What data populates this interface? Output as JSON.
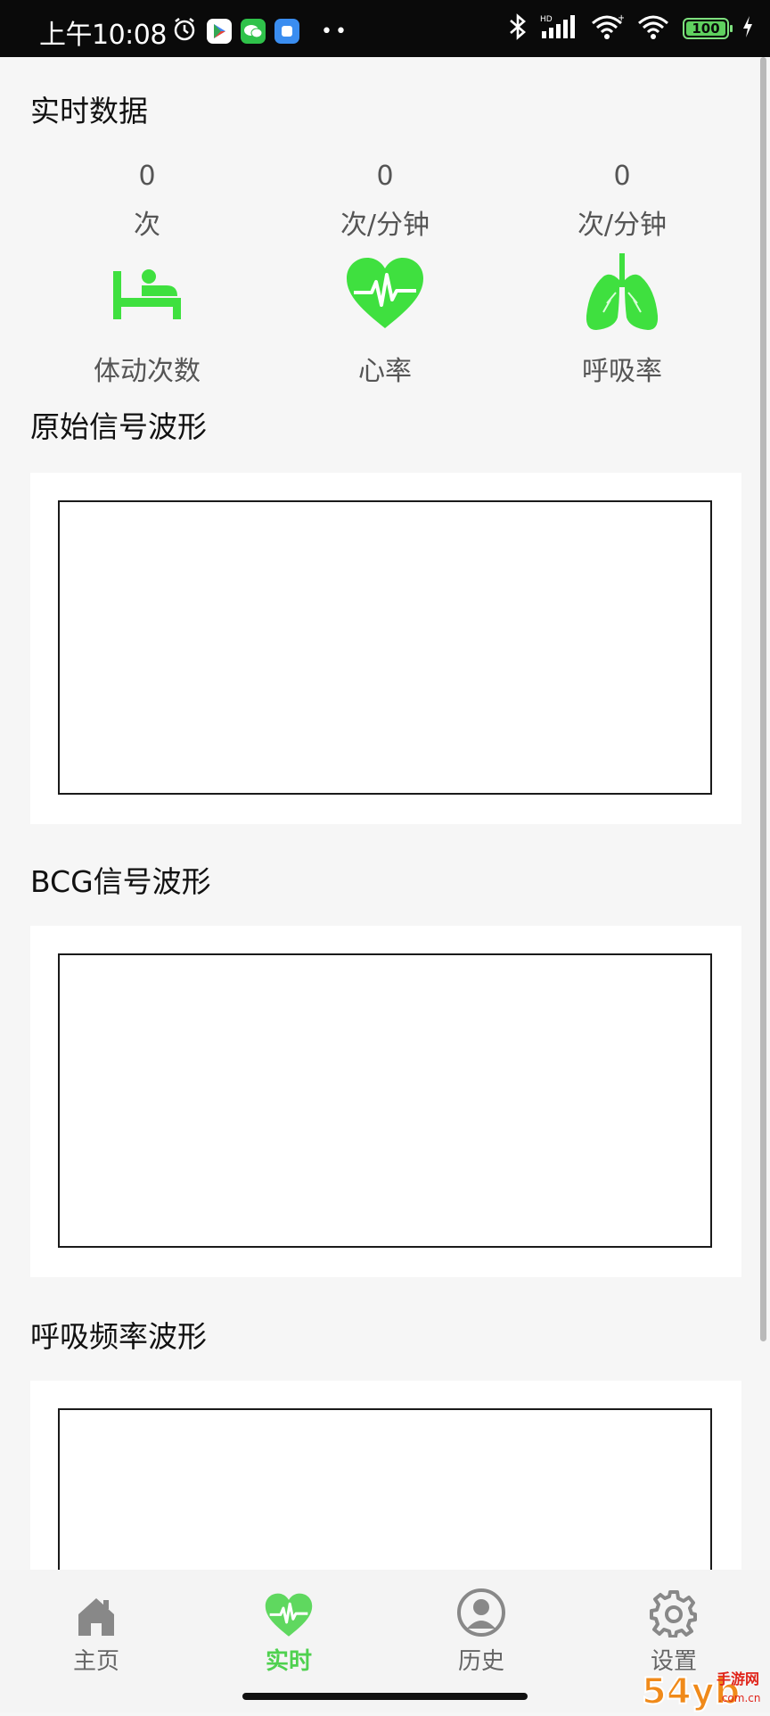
{
  "status_bar": {
    "time": "上午10:08",
    "battery": "100",
    "apps": [
      "alarm-icon",
      "play-store-icon",
      "wechat-icon",
      "app-icon"
    ]
  },
  "realtime": {
    "title": "实时数据",
    "metrics": [
      {
        "value": "0",
        "unit": "次",
        "label": "体动次数",
        "icon": "bed-person-icon"
      },
      {
        "value": "0",
        "unit": "次/分钟",
        "label": "心率",
        "icon": "heart-pulse-icon"
      },
      {
        "value": "0",
        "unit": "次/分钟",
        "label": "呼吸率",
        "icon": "lungs-icon"
      }
    ]
  },
  "charts": [
    {
      "title": "原始信号波形"
    },
    {
      "title": "BCG信号波形"
    },
    {
      "title": "呼吸频率波形"
    }
  ],
  "nav": [
    {
      "label": "主页",
      "icon": "home-icon",
      "active": false
    },
    {
      "label": "实时",
      "icon": "heart-pulse-icon",
      "active": true
    },
    {
      "label": "历史",
      "icon": "person-icon",
      "active": false
    },
    {
      "label": "设置",
      "icon": "gear-icon",
      "active": false
    }
  ],
  "watermark": {
    "text": "54yb",
    "sub": "手游网",
    "domain": ".com.cn"
  },
  "colors": {
    "accent": "#3fe03f",
    "text_muted": "#555555",
    "card": "#ffffff",
    "background": "#f6f6f6"
  }
}
